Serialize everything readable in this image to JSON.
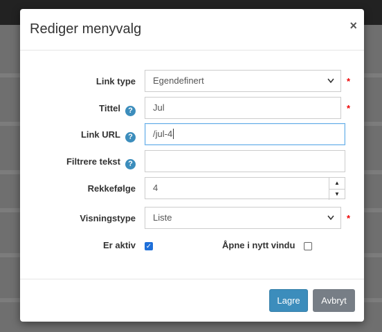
{
  "modal": {
    "title": "Rediger menyvalg",
    "close_label": "×"
  },
  "form": {
    "link_type": {
      "label": "Link type",
      "value": "Egendefinert",
      "required": "*"
    },
    "title": {
      "label": "Tittel",
      "value": "Jul",
      "required": "*"
    },
    "link_url": {
      "label": "Link URL",
      "value": "/jul-4"
    },
    "filter_text": {
      "label": "Filtrere tekst",
      "value": ""
    },
    "order": {
      "label": "Rekkefølge",
      "value": "4"
    },
    "display_type": {
      "label": "Visningstype",
      "value": "Liste",
      "required": "*"
    },
    "active": {
      "label": "Er aktiv",
      "checked": true
    },
    "new_window": {
      "label": "Åpne i nytt vindu",
      "checked": false
    }
  },
  "footer": {
    "save_label": "Lagre",
    "cancel_label": "Avbryt"
  },
  "icons": {
    "help": "?",
    "chevron": "⌵",
    "spin_up": "▲",
    "spin_down": "▼",
    "check": "✓"
  },
  "colors": {
    "accent": "#3c8dbc",
    "required": "#ee0000",
    "cancel": "#777e86"
  }
}
